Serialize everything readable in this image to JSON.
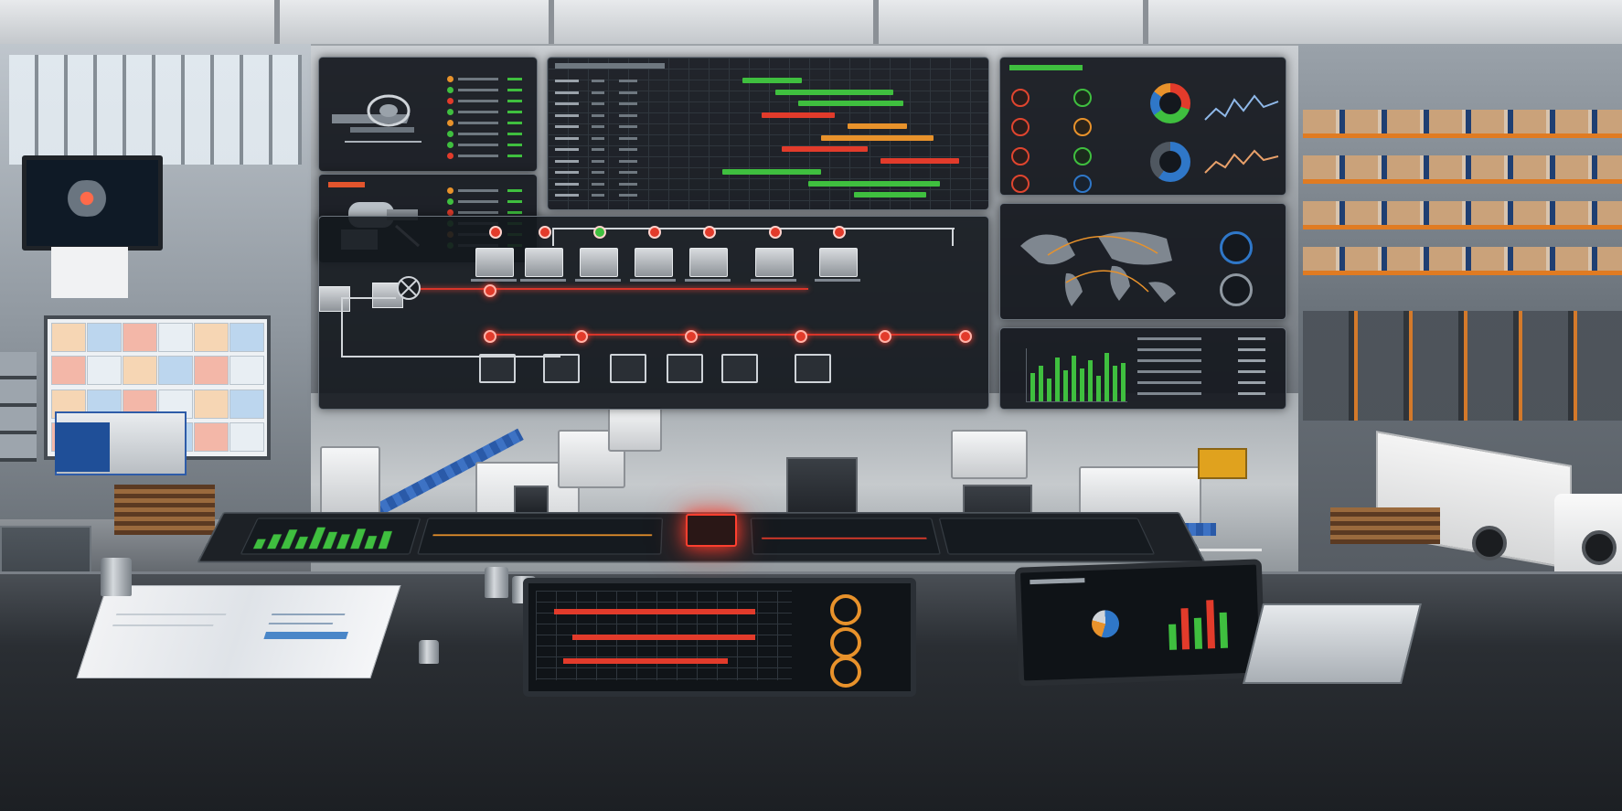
{
  "scene": {
    "description_colors": {
      "accent_red": "#e23b2b",
      "accent_green": "#3fbf3f",
      "accent_orange": "#e8922b",
      "accent_blue": "#2f77c8",
      "panel_bg": "#14181e"
    }
  },
  "gantt": {
    "rows": [
      {
        "start": 0.28,
        "len": 0.18,
        "color": "#3fbf3f"
      },
      {
        "start": 0.38,
        "len": 0.36,
        "color": "#3fbf3f"
      },
      {
        "start": 0.45,
        "len": 0.32,
        "color": "#3fbf3f"
      },
      {
        "start": 0.34,
        "len": 0.22,
        "color": "#e23b2b"
      },
      {
        "start": 0.6,
        "len": 0.18,
        "color": "#e8922b"
      },
      {
        "start": 0.52,
        "len": 0.34,
        "color": "#e8922b"
      },
      {
        "start": 0.4,
        "len": 0.26,
        "color": "#e23b2b"
      },
      {
        "start": 0.7,
        "len": 0.24,
        "color": "#e23b2b"
      },
      {
        "start": 0.22,
        "len": 0.3,
        "color": "#3fbf3f"
      },
      {
        "start": 0.48,
        "len": 0.4,
        "color": "#3fbf3f"
      },
      {
        "start": 0.62,
        "len": 0.22,
        "color": "#3fbf3f"
      }
    ]
  },
  "status_panel": {
    "dots": [
      "#e8922b",
      "#3fbf3f",
      "#e23b2b",
      "#3fbf3f",
      "#e8922b",
      "#3fbf3f",
      "#3fbf3f",
      "#e23b2b"
    ]
  },
  "bar_panel": {
    "values": [
      0.55,
      0.7,
      0.45,
      0.85,
      0.6,
      0.9,
      0.65,
      0.8,
      0.5,
      0.95,
      0.7,
      0.75
    ]
  },
  "strip_bars": {
    "values": [
      0.4,
      0.6,
      0.8,
      0.5,
      0.9,
      0.7,
      0.6,
      0.85,
      0.55,
      0.75
    ]
  }
}
